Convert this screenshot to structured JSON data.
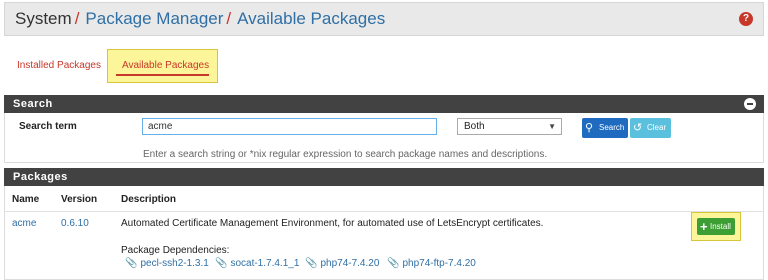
{
  "breadcrumb": {
    "system": "System",
    "separator": "/",
    "package_manager": "Package Manager",
    "current": "Available Packages"
  },
  "help_icon": "?",
  "tabs": [
    {
      "label": "Installed Packages",
      "active": false
    },
    {
      "label": "Available Packages",
      "active": true
    }
  ],
  "search_panel": {
    "title": "Search",
    "term_label": "Search term",
    "term_value": "acme",
    "scope_selected": "Both",
    "search_button": "Search",
    "clear_button": "Clear",
    "hint": "Enter a search string or *nix regular expression to search package names and descriptions."
  },
  "packages_panel": {
    "title": "Packages",
    "columns": [
      "Name",
      "Version",
      "Description"
    ],
    "rows": [
      {
        "name": "acme",
        "version": "0.6.10",
        "description": "Automated Certificate Management Environment, for automated use of LetsEncrypt certificates.",
        "dependencies_label": "Package Dependencies:",
        "dependencies": [
          "pecl-ssh2-1.3.1",
          "socat-1.7.4.1_1",
          "php74-7.4.20",
          "php74-ftp-7.4.20"
        ],
        "install_button": "Install"
      }
    ]
  },
  "colors": {
    "accent_red": "#c7372a",
    "link_blue": "#2f6fa5",
    "panel_header": "#424242",
    "highlight_yellow": "#fdf59a",
    "install_green": "#3c9e33"
  },
  "icons": {
    "help": "question-circle-icon",
    "collapse": "minus-circle-icon",
    "search": "search-icon",
    "clear": "undo-icon",
    "dependency": "paperclip-icon",
    "install": "plus-icon"
  }
}
